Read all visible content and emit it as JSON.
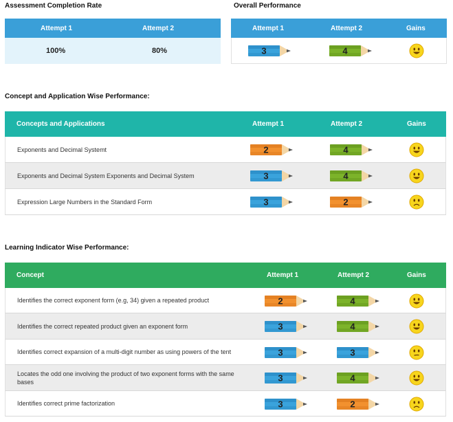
{
  "completion": {
    "title": "Assessment Completion Rate",
    "headers": [
      "Attempt 1",
      "Attempt 2"
    ],
    "values": [
      "100%",
      "80%"
    ]
  },
  "overall": {
    "title": "Overall Performance",
    "headers": [
      "Attempt 1",
      "Attempt 2",
      "Gains"
    ],
    "attempt1": "3",
    "attempt2": "4",
    "gains": "happy"
  },
  "concept": {
    "title": "Concept and Application Wise Performance:",
    "headers": [
      "Concepts and Applications",
      "Attempt 1",
      "Attempt 2",
      "Gains"
    ],
    "rows": [
      {
        "label": "Exponents and Decimal Systemt",
        "a1": "2",
        "a2": "4",
        "gains": "happy"
      },
      {
        "label": "Exponents and Decimal System Exponents and Decimal System",
        "a1": "3",
        "a2": "4",
        "gains": "happy"
      },
      {
        "label": "Expression Large Numbers in the Standard Form",
        "a1": "3",
        "a2": "2",
        "gains": "sad"
      }
    ]
  },
  "indicator": {
    "title": "Learning Indicator Wise Performance:",
    "headers": [
      "Concept",
      "Attempt 1",
      "Attempt 2",
      "Gains"
    ],
    "rows": [
      {
        "label": "Identifies the correct exponent form (e.g, 34) given a repeated product",
        "a1": "2",
        "a2": "4",
        "gains": "happy"
      },
      {
        "label": "Identifies the correct repeated product given an exponent form",
        "a1": "3",
        "a2": "4",
        "gains": "happy"
      },
      {
        "label": "Identifies correct expansion of a multi-digit number as using powers of the tent",
        "a1": "3",
        "a2": "3",
        "gains": "neutral"
      },
      {
        "label": "Locates the odd one involving the product of two exponent forms with the same bases",
        "a1": "3",
        "a2": "4",
        "gains": "happy"
      },
      {
        "label": "Identifies correct prime factorization",
        "a1": "3",
        "a2": "2",
        "gains": "sad"
      }
    ]
  },
  "colors": {
    "blue_header": "#3a9fd8",
    "teal_header": "#1fb5a9",
    "green_header": "#2fab5f",
    "light_blue_row": "#e3f3fb",
    "grey_row": "#ececec",
    "pencil_blue": "#3aa3dc",
    "pencil_green": "#7cb32a",
    "pencil_orange": "#f2912f"
  }
}
